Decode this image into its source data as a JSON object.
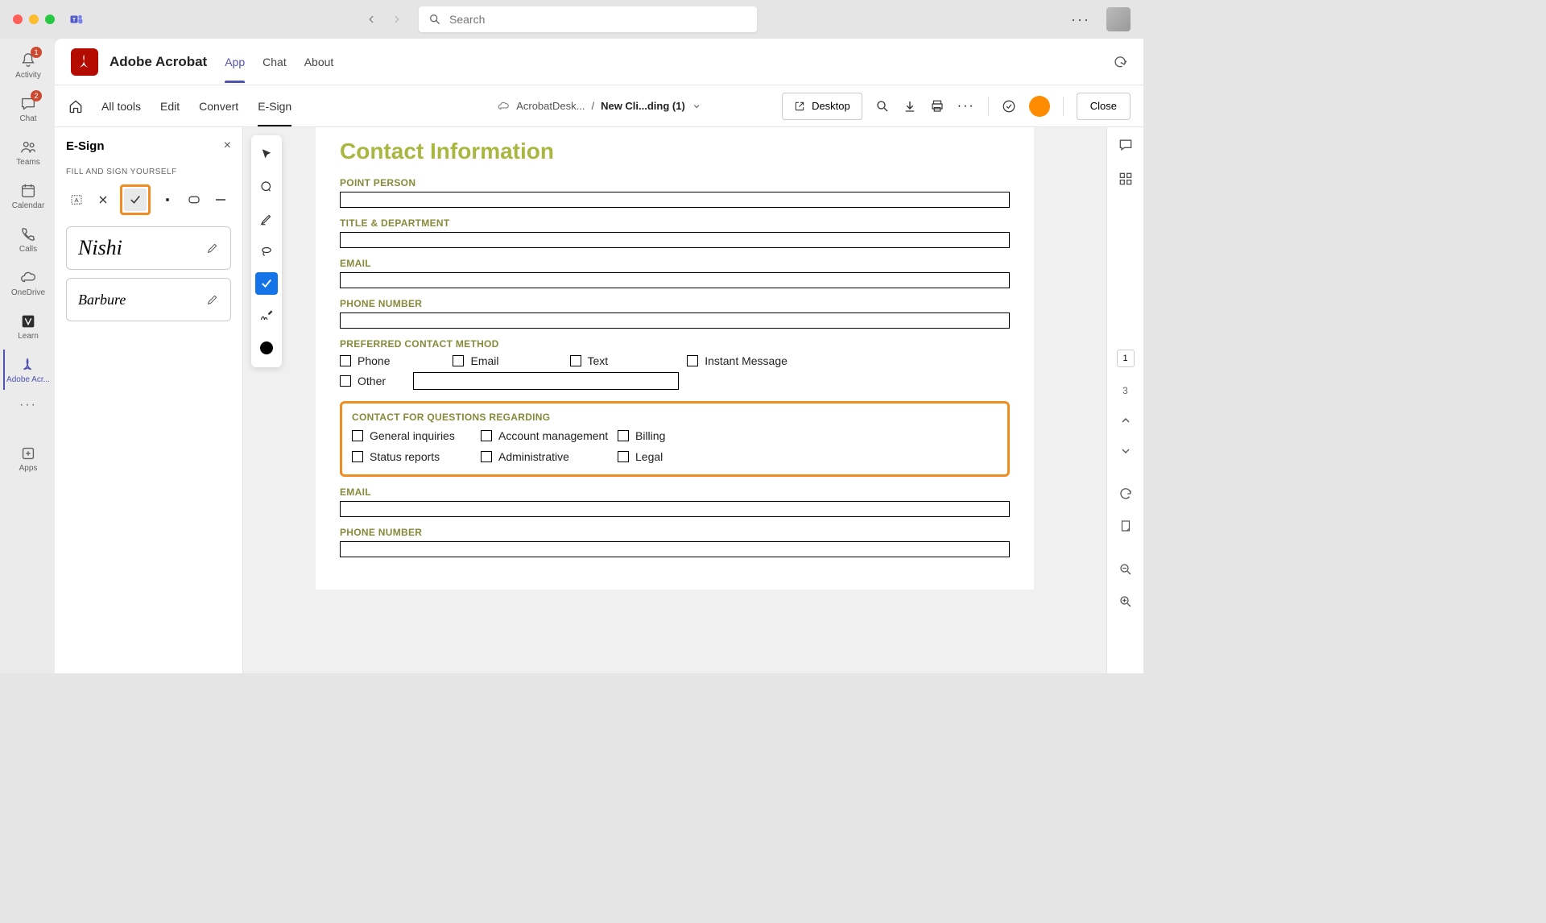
{
  "search": {
    "placeholder": "Search"
  },
  "rail": {
    "activity": {
      "label": "Activity",
      "badge": "1"
    },
    "chat": {
      "label": "Chat",
      "badge": "2"
    },
    "teams": {
      "label": "Teams"
    },
    "calendar": {
      "label": "Calendar"
    },
    "calls": {
      "label": "Calls"
    },
    "onedrive": {
      "label": "OneDrive"
    },
    "learn": {
      "label": "Learn"
    },
    "acrobat": {
      "label": "Adobe Acr..."
    },
    "apps": {
      "label": "Apps"
    }
  },
  "app": {
    "title": "Adobe Acrobat",
    "tabs": {
      "app": "App",
      "chat": "Chat",
      "about": "About"
    }
  },
  "toolbar": {
    "all_tools": "All tools",
    "edit": "Edit",
    "convert": "Convert",
    "esign": "E-Sign",
    "breadcrumb_root": "AcrobatDesk...",
    "breadcrumb_current": "New Cli...ding (1)",
    "desktop": "Desktop",
    "close": "Close"
  },
  "panel": {
    "title": "E-Sign",
    "subtitle": "FILL AND SIGN YOURSELF",
    "signature1": "Nishi",
    "signature2": "Barbure"
  },
  "doc": {
    "heading": "Contact Information",
    "labels": {
      "point_person": "POINT PERSON",
      "title_dept": "TITLE & DEPARTMENT",
      "email": "EMAIL",
      "phone": "PHONE NUMBER",
      "pref_method": "PREFERRED CONTACT METHOD",
      "questions": "CONTACT FOR QUESTIONS REGARDING",
      "email2": "EMAIL",
      "phone2": "PHONE NUMBER"
    },
    "contact_methods": {
      "phone": "Phone",
      "email": "Email",
      "text": "Text",
      "im": "Instant Message",
      "other": "Other"
    },
    "questions": {
      "general": "General inquiries",
      "account": "Account management",
      "billing": "Billing",
      "status": "Status reports",
      "admin": "Administrative",
      "legal": "Legal"
    }
  },
  "right": {
    "current_page": "1",
    "total_pages": "3"
  }
}
